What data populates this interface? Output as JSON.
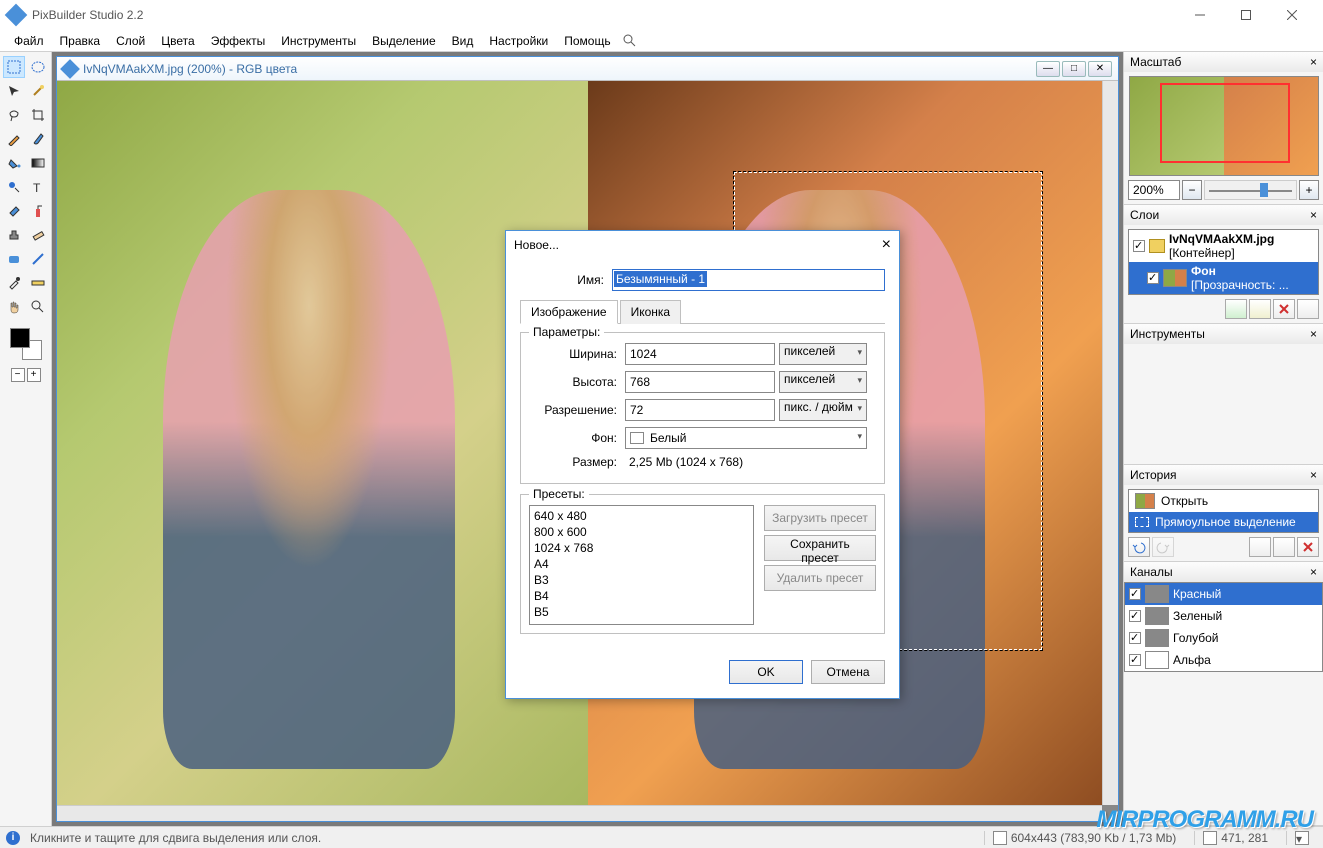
{
  "app": {
    "title": "PixBuilder Studio 2.2"
  },
  "menu": [
    "Файл",
    "Правка",
    "Слой",
    "Цвета",
    "Эффекты",
    "Инструменты",
    "Выделение",
    "Вид",
    "Настройки",
    "Помощь"
  ],
  "document": {
    "title": "IvNqVMAakXM.jpg (200%) - RGB цвета"
  },
  "panels": {
    "navigator": {
      "title": "Масштаб",
      "zoom_value": "200%"
    },
    "layers": {
      "title": "Слои",
      "items": [
        {
          "name": "IvNqVMAakXM.jpg",
          "sub": "[Контейнер]",
          "type": "folder"
        },
        {
          "name": "Фон",
          "sub": "[Прозрачность: ...",
          "type": "layer",
          "selected": true
        }
      ]
    },
    "instruments": {
      "title": "Инструменты"
    },
    "history": {
      "title": "История",
      "items": [
        {
          "label": "Открыть"
        },
        {
          "label": "Прямоульное выделение",
          "selected": true
        }
      ]
    },
    "channels": {
      "title": "Каналы",
      "items": [
        {
          "label": "Красный",
          "selected": true
        },
        {
          "label": "Зеленый"
        },
        {
          "label": "Голубой"
        },
        {
          "label": "Альфа",
          "channel": "alpha"
        }
      ]
    }
  },
  "dialog": {
    "title": "Новое...",
    "name_label": "Имя:",
    "name_value": "Безымянный - 1",
    "tabs": {
      "image": "Изображение",
      "icon": "Иконка"
    },
    "params": {
      "legend": "Параметры:",
      "width_label": "Ширина:",
      "width_value": "1024",
      "width_unit": "пикселей",
      "height_label": "Высота:",
      "height_value": "768",
      "height_unit": "пикселей",
      "res_label": "Разрешение:",
      "res_value": "72",
      "res_unit": "пикс. / дюйм",
      "bg_label": "Фон:",
      "bg_value": "Белый",
      "size_label": "Размер:",
      "size_value": "2,25 Mb  (1024 x 768)"
    },
    "presets": {
      "legend": "Пресеты:",
      "items": [
        "640 x 480",
        "800 x 600",
        "1024 x 768",
        "A4",
        "B3",
        "B4",
        "B5"
      ],
      "load": "Загрузить пресет",
      "save": "Сохранить пресет",
      "delete": "Удалить пресет"
    },
    "buttons": {
      "ok": "OK",
      "cancel": "Отмена"
    }
  },
  "status": {
    "hint": "Кликните и тащите для сдвига выделения или слоя.",
    "dims": "604x443  (783,90 Kb / 1,73 Mb)",
    "coords": "471, 281"
  },
  "watermark": "MIRPROGRAMM.RU"
}
